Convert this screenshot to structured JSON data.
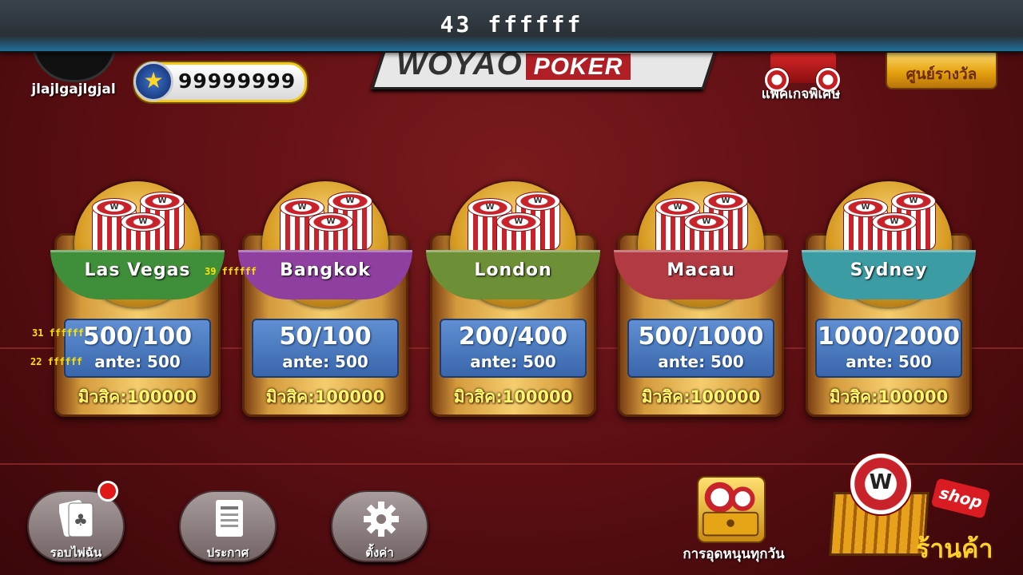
{
  "debug_bar": {
    "text": "43  ffffff"
  },
  "player": {
    "username": "jlajlgajlgjal",
    "coins": "99999999"
  },
  "logo": {
    "main": "WOYAO",
    "sub": "POKER"
  },
  "header": {
    "special_pack_label": "แพคเกจพิเศษ",
    "reward_center_label": "ศูนย์รางวัล"
  },
  "tables": [
    {
      "name": "Las Vegas",
      "blinds": "500/100",
      "ante": "ante: 500",
      "min_buyin": "มิวสิค:100000",
      "color": "#3f8f3a"
    },
    {
      "name": "Bangkok",
      "blinds": "50/100",
      "ante": "ante: 500",
      "min_buyin": "มิวสิค:100000",
      "color": "#8e3fa0"
    },
    {
      "name": "London",
      "blinds": "200/400",
      "ante": "ante: 500",
      "min_buyin": "มิวสิค:100000",
      "color": "#6d8f35"
    },
    {
      "name": "Macau",
      "blinds": "500/1000",
      "ante": "ante: 500",
      "min_buyin": "มิวสิค:100000",
      "color": "#b23a42"
    },
    {
      "name": "Sydney",
      "blinds": "1000/2000",
      "ante": "ante: 500",
      "min_buyin": "มิวสิค:100000",
      "color": "#3b9ca3"
    }
  ],
  "debug_labels": {
    "a": "39  ffffff",
    "b": "31  ffffff",
    "c": "22  ffffff"
  },
  "bottom": {
    "hand_rank_label": "รอบไพ่ฉัน",
    "announce_label": "ประกาศ",
    "settings_label": "ตั้งค่า",
    "daily_label": "การอุดหนุนทุกวัน",
    "shop_tag": "shop",
    "shop_label": "ร้านค้า"
  },
  "chip_mark": "W"
}
